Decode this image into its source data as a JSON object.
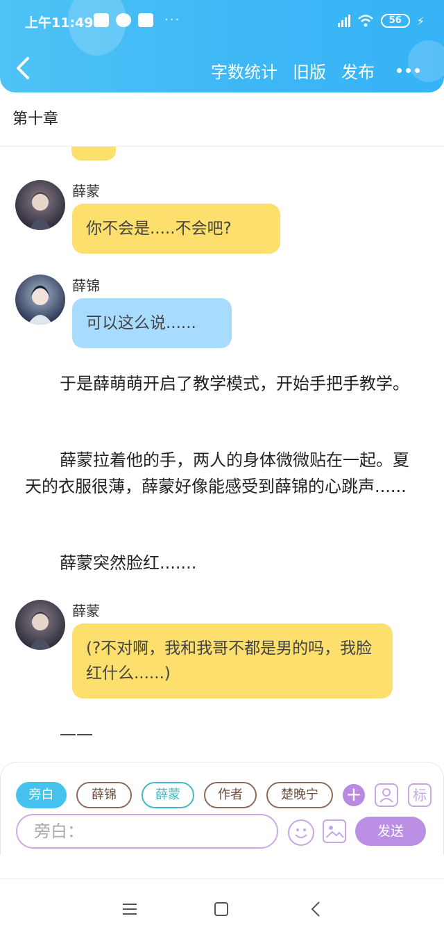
{
  "status_bar": {
    "time": "上午11:49",
    "battery": "56"
  },
  "header": {
    "actions": [
      "字数统计",
      "旧版",
      "发布"
    ]
  },
  "chapter": {
    "title": "第十章"
  },
  "messages": [
    {
      "name": "薛蒙",
      "text": "你不会是.....不会吧?",
      "bubble_color": "#fddf6d"
    },
    {
      "name": "薛锦",
      "text": "可以这么说......",
      "bubble_color": "#a7dcff"
    },
    {
      "name": "薛蒙",
      "text": "(?不对啊，我和我哥不都是男的吗，我脸红什么......)",
      "bubble_color": "#fddf6d"
    }
  ],
  "paragraphs": [
    "于是薛萌萌开启了教学模式，开始手把手教学。",
    "薛蒙拉着他的手，两人的身体微微贴在一起。夏天的衣服很薄，薛蒙好像能感受到薛锦的心跳声......",
    "薛蒙突然脸红.......",
    "——"
  ],
  "composer": {
    "roles": [
      "旁白",
      "薛锦",
      "薛蒙",
      "作者",
      "楚晚宁"
    ],
    "add_label": "+",
    "tag_label": "标",
    "placeholder": "旁白：",
    "send_label": "发送"
  },
  "colors": {
    "header": "#3fb8f5",
    "yellow_bubble": "#fddf6d",
    "blue_bubble": "#a7dcff",
    "accent_purple": "#bb8fe3"
  }
}
